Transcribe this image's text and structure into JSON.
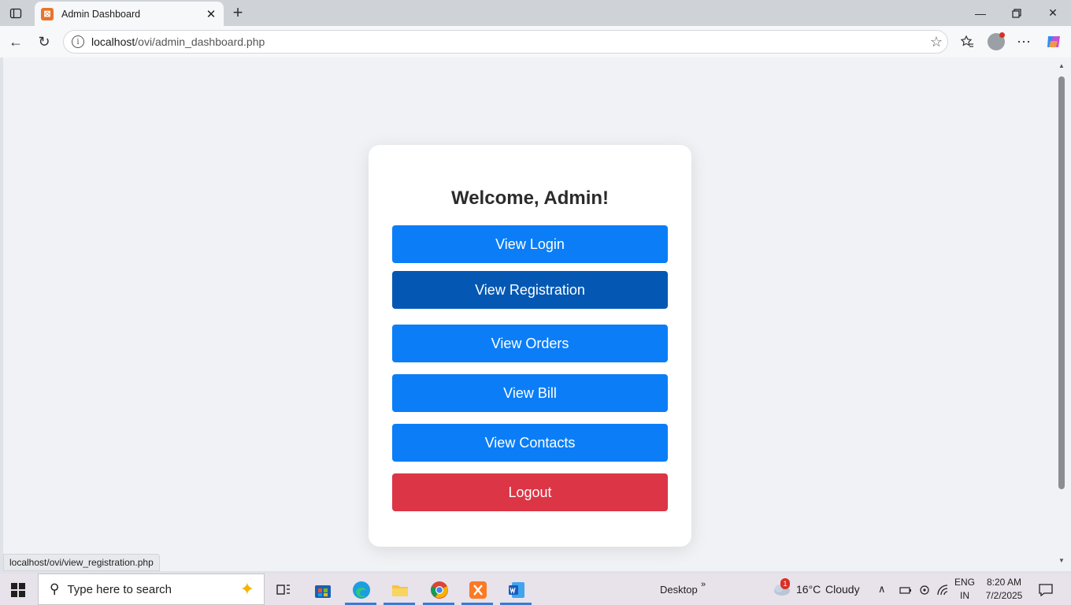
{
  "browser": {
    "tab_title": "Admin Dashboard",
    "url_host": "localhost",
    "url_path": "/ovi/admin_dashboard.php",
    "status_link": "localhost/ovi/view_registration.php"
  },
  "page": {
    "heading": "Welcome, Admin!",
    "buttons": [
      {
        "label": "View Login",
        "color": "#0b7ef7"
      },
      {
        "label": "View Registration",
        "color": "#0458b4"
      },
      {
        "label": "View Orders",
        "color": "#0b7ef7"
      },
      {
        "label": "View Bill",
        "color": "#0b7ef7"
      },
      {
        "label": "View Contacts",
        "color": "#0b7ef7"
      },
      {
        "label": "Logout",
        "color": "#dc3545"
      }
    ]
  },
  "taskbar": {
    "search_placeholder": "Type here to search",
    "desktop_label": "Desktop",
    "weather_temp": "16°C",
    "weather_desc": "Cloudy",
    "weather_badge": "1",
    "lang_line1": "ENG",
    "lang_line2": "IN",
    "time": "8:20 AM",
    "date": "7/2/2025"
  }
}
